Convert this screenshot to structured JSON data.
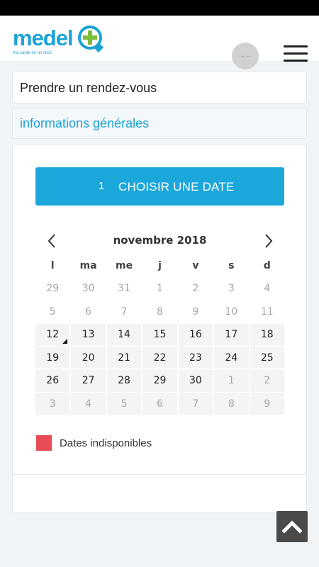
{
  "header": {
    "logo_part1": "medel",
    "logo_tagline": "ma santé en un click",
    "avatar_text": "••• ••"
  },
  "page": {
    "title": "Prendre un rendez-vous",
    "info_section": "informations générales"
  },
  "step": {
    "number": "1",
    "label": "CHOISIR UNE DATE"
  },
  "calendar": {
    "month": "novembre 2018",
    "weekdays": [
      "l",
      "ma",
      "me",
      "j",
      "v",
      "s",
      "d"
    ],
    "weeks": [
      [
        "29",
        "30",
        "31",
        "1",
        "2",
        "3",
        "4"
      ],
      [
        "5",
        "6",
        "7",
        "8",
        "9",
        "10",
        "11"
      ],
      [
        "12",
        "13",
        "14",
        "15",
        "16",
        "17",
        "18"
      ],
      [
        "19",
        "20",
        "21",
        "22",
        "23",
        "24",
        "25"
      ],
      [
        "26",
        "27",
        "28",
        "29",
        "30",
        "1",
        "2"
      ],
      [
        "3",
        "4",
        "5",
        "6",
        "7",
        "8",
        "9"
      ]
    ],
    "today": "12"
  },
  "legend": {
    "label": "Dates indisponibles",
    "color": "#e84c55"
  },
  "colors": {
    "accent": "#1ca7db",
    "brand_green": "#7dbb3a"
  },
  "icons": {
    "menu": "hamburger-icon",
    "prev": "chevron-left-icon",
    "next": "chevron-right-icon",
    "scroll_top": "chevron-up-icon"
  }
}
